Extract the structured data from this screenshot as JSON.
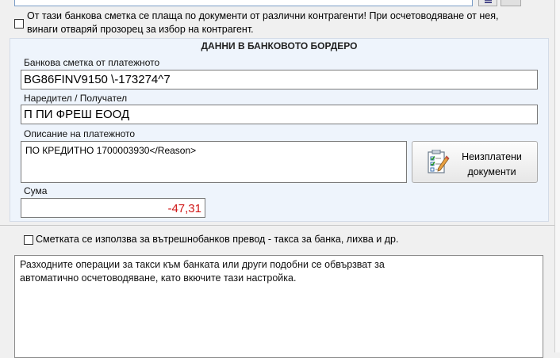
{
  "foreign_account_warning": {
    "checked": false,
    "line1": "От тази банкова сметка се плаща по документи от различни контрагенти! При осчетоводяване от нея,",
    "line2": "винаги отваряй прозорец за избор на контрагент."
  },
  "statement_panel": {
    "title": "ДАННИ В БАНКОВОТО БОРДЕРО",
    "account_label": "Банкова сметка от платежното",
    "account_value": "BG86FINV9150 \\-173274^7",
    "party_label": "Наредител / Получател",
    "party_value": "П   ПИ ФРЕШ ЕООД",
    "description_label": "Описание на платежното",
    "description_value": "ПО КРЕДИТНО 1700003930</Reason>",
    "unpaid_button": {
      "line1": "Неизплатени",
      "line2": "документи",
      "icon": "checklist-pencil-icon"
    },
    "amount_label": "Сума",
    "amount_value": "-47,31",
    "amount_color": "#d01818"
  },
  "internal_transfer": {
    "checked": false,
    "label": "Сметката се използва за вътрешнобанков превод - такса за банка, лихва и др."
  },
  "info": {
    "line1": "Разходните операции за такси към банката или други подобни се обвързват за",
    "line2": "автоматично осчетоводяване, като вкючите тази настройка."
  }
}
